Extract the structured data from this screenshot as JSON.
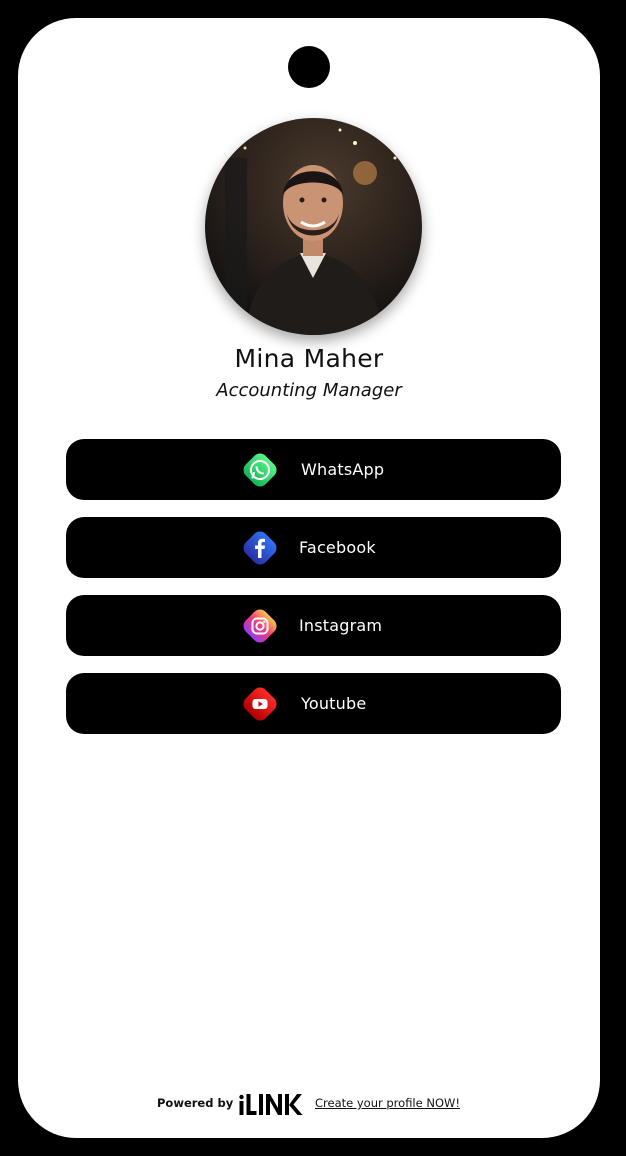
{
  "profile": {
    "name": "Mina Maher",
    "title": "Accounting Manager",
    "avatar_icon": "profile-photo"
  },
  "links": [
    {
      "label": "WhatsApp",
      "icon": "whatsapp-icon",
      "color": "#25D366"
    },
    {
      "label": "Facebook",
      "icon": "facebook-icon",
      "color": "#2A47C9"
    },
    {
      "label": "Instagram",
      "icon": "instagram-icon",
      "color": "#E1306C"
    },
    {
      "label": "Youtube",
      "icon": "youtube-icon",
      "color": "#E00000"
    }
  ],
  "footer": {
    "powered_by": "Powered by",
    "brand": "iLINK",
    "cta": "Create your profile NOW!"
  }
}
